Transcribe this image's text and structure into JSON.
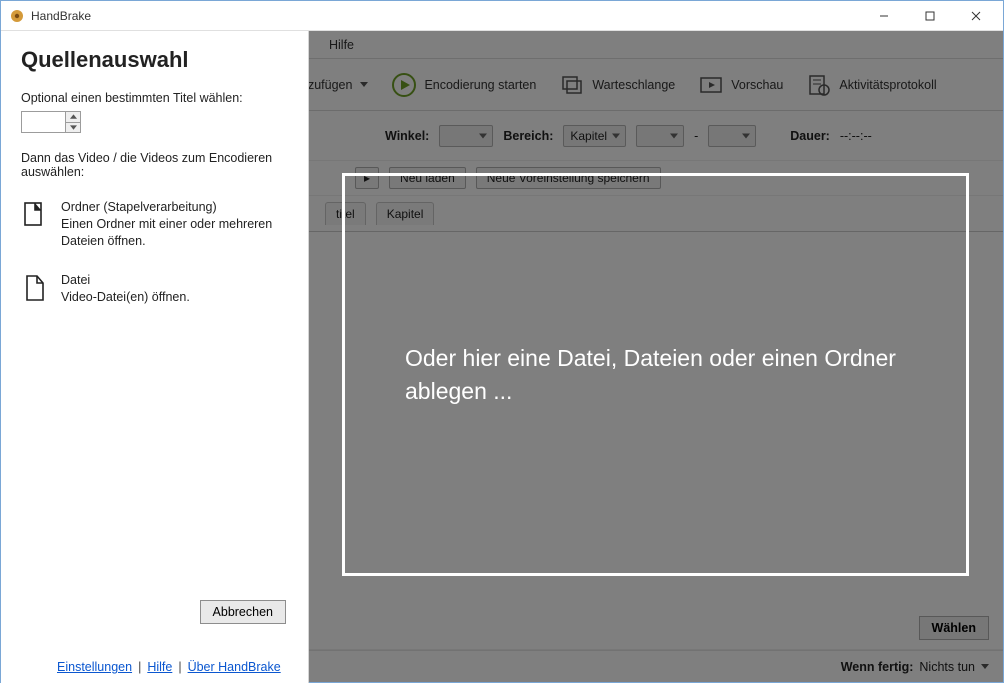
{
  "window": {
    "title": "HandBrake"
  },
  "menubar": {
    "help": "Hilfe"
  },
  "toolbar": {
    "add_suffix_label": "nzufügen",
    "start_label": "Encodierung starten",
    "queue_label": "Warteschlange",
    "preview_label": "Vorschau",
    "activity_label": "Aktivitätsprotokoll"
  },
  "source_row": {
    "angle_label": "Winkel:",
    "range_label": "Bereich:",
    "range_value": "Kapitel",
    "dash": "-",
    "duration_label": "Dauer:",
    "duration_value": "--:--:--"
  },
  "preset_row": {
    "reload_label": "Neu laden",
    "save_preset_label": "Neue Voreinstellung speichern"
  },
  "tabs": {
    "subtitle": "titel",
    "chapters": "Kapitel"
  },
  "dropzone": {
    "text": "Oder hier eine Datei, Dateien oder einen Ordner ablegen ..."
  },
  "save_row": {
    "choose_label": "Wählen"
  },
  "status": {
    "when_done_label": "Wenn fertig:",
    "when_done_value": "Nichts tun"
  },
  "panel": {
    "heading": "Quellenauswahl",
    "optional_title_label": "Optional einen bestimmten Titel wählen:",
    "then_select_label": "Dann das Video / die Videos zum Encodieren auswählen:",
    "folder_title": "Ordner (Stapelverarbeitung)",
    "folder_desc": "Einen Ordner mit einer oder mehreren Dateien öffnen.",
    "file_title": "Datei",
    "file_desc": "Video-Datei(en) öffnen.",
    "cancel_label": "Abbrechen",
    "link_settings": "Einstellungen",
    "link_help": "Hilfe",
    "link_about": "Über HandBrake"
  }
}
